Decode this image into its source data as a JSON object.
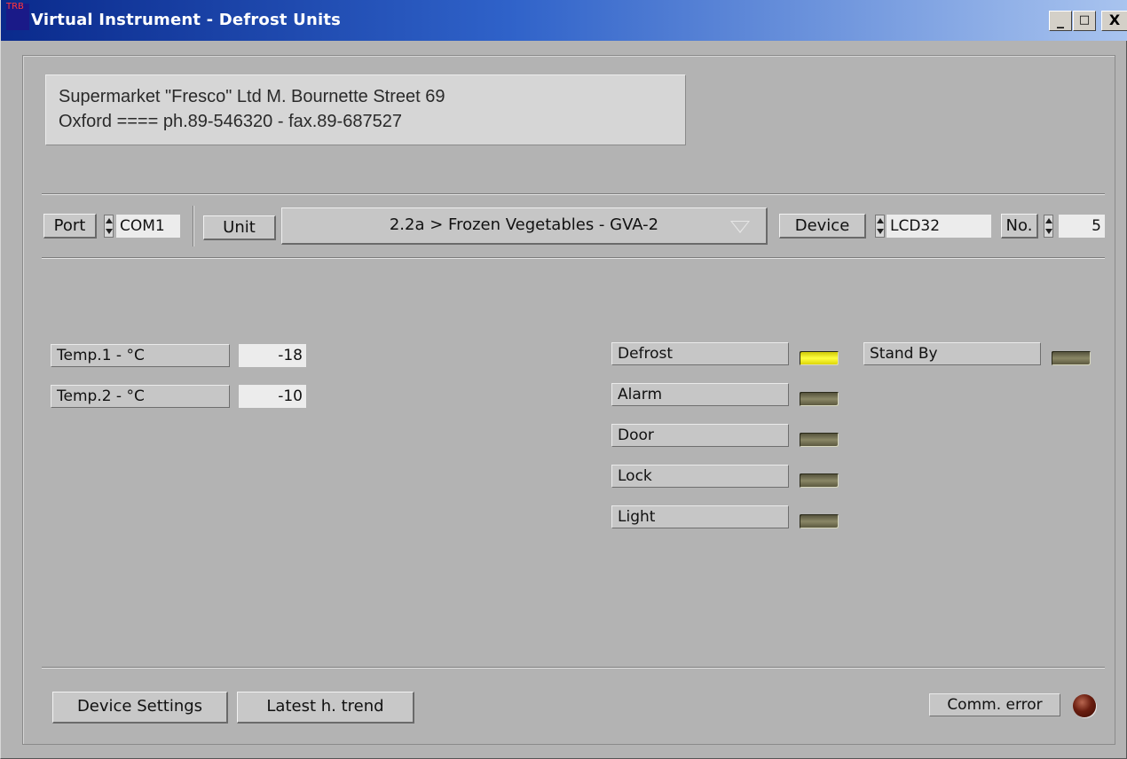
{
  "window": {
    "title": "Virtual Instrument - Defrost Units",
    "icon_text": "TRB",
    "minimize": "_",
    "maximize": "□",
    "close": "X"
  },
  "company": {
    "line1": "Supermarket \"Fresco\" Ltd  M. Bournette Street 69",
    "line2": "Oxford   ====    ph.89-546320 - fax.89-687527"
  },
  "toolbar": {
    "port_label": "Port",
    "port_value": "COM1",
    "unit_label": "Unit",
    "unit_value": "2.2a > Frozen Vegetables - GVA-2",
    "device_label": "Device",
    "device_value": "LCD32",
    "no_label": "No.",
    "no_value": "5"
  },
  "temps": [
    {
      "label": "Temp.1 - °C",
      "value": "-18"
    },
    {
      "label": "Temp.2 - °C",
      "value": "-10"
    }
  ],
  "indicators": [
    {
      "label": "Defrost",
      "on": true
    },
    {
      "label": "Alarm",
      "on": false
    },
    {
      "label": "Door",
      "on": false
    },
    {
      "label": "Lock",
      "on": false
    },
    {
      "label": "Light",
      "on": false
    }
  ],
  "standby": {
    "label": "Stand By",
    "on": false
  },
  "footer": {
    "device_settings": "Device Settings",
    "latest_trend": "Latest h. trend",
    "comm_error": "Comm. error"
  },
  "colors": {
    "led_on": "#ffff40",
    "led_off": "#6e6b50",
    "comm_led": "#6a1e10",
    "title_bar": "#0a2a8c"
  }
}
